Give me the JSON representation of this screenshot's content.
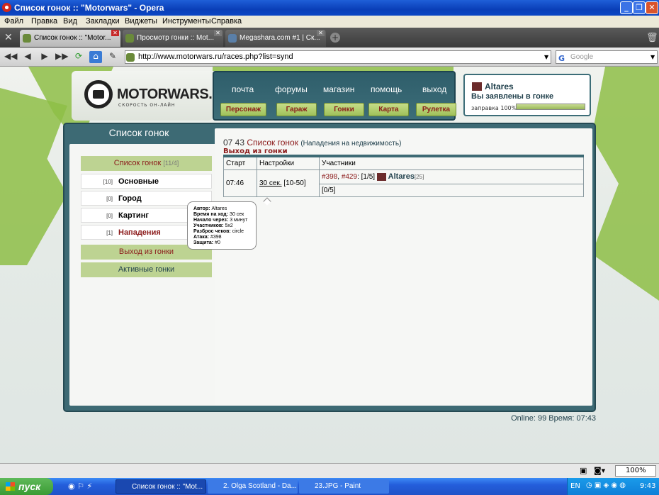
{
  "window": {
    "title": "Список гонок :: \"Motorwars\" - Opera"
  },
  "menu": [
    "Файл",
    "Правка",
    "Вид",
    "Закладки",
    "Виджеты",
    "Инструменты",
    "Справка"
  ],
  "tabs": [
    {
      "label": "Список гонок :: \"Motor...",
      "active": true
    },
    {
      "label": "Просмотр гонки :: Mot...",
      "active": false
    },
    {
      "label": "Megashara.com #1 | Ск...",
      "active": false
    }
  ],
  "address": {
    "url": "http://www.motorwars.ru/races.php?list=synd",
    "search_placeholder": "Google"
  },
  "site": {
    "logo": "MOTORWARS.RU",
    "slogan": "СКОРОСТЬ ОН-ЛАЙН",
    "top_nav": [
      "почта",
      "форумы",
      "магазин",
      "помощь",
      "выход"
    ],
    "sub_nav": [
      "Персонаж",
      "Гараж",
      "Гонки",
      "Карта",
      "Рулетка"
    ],
    "user": {
      "name": "Altares",
      "status": "Вы заявлены в гонке",
      "fuel_label": "заправка 100%",
      "fuel_fraction": 1.0
    }
  },
  "sidebar": {
    "title": "Список гонок",
    "header_item": {
      "label": "Список гонок",
      "count": "[11/4]"
    },
    "items": [
      {
        "count": "[10]",
        "label": "Основные"
      },
      {
        "count": "[0]",
        "label": "Город"
      },
      {
        "count": "[0]",
        "label": "Картинг"
      },
      {
        "count": "[1]",
        "label": "Нападения"
      }
    ],
    "exit": "Выход из гонки",
    "active": "Активные гонки"
  },
  "content": {
    "time": "07 43",
    "title": "Список гонок",
    "subtitle": "(Нападения на недвижимость)",
    "exit_link": "Выход из гонки",
    "table": {
      "headers": [
        "Старт",
        "Настройки",
        "Участники"
      ],
      "row": {
        "start": "07:46",
        "settings_link": "30 сек.",
        "settings_range": "[10-50]",
        "participants_a": "#398",
        "participants_b": "#429",
        "participants_count": "[1/5]",
        "participant_name": "Altares",
        "participant_level": "[25]",
        "defenders": "[0/5]"
      }
    },
    "tooltip": [
      {
        "k": "Автор:",
        "v": "Altares"
      },
      {
        "k": "Время на ход:",
        "v": "30 сек"
      },
      {
        "k": "Начало через:",
        "v": "3 минут"
      },
      {
        "k": "Участников:",
        "v": "5x2"
      },
      {
        "k": "Разброс чеков:",
        "v": "circle"
      },
      {
        "k": "Атака:",
        "v": "#398"
      },
      {
        "k": "Защита:",
        "v": "#0"
      }
    ]
  },
  "footer": {
    "online": "Online: 99  Время: 07:43"
  },
  "statusbar": {
    "zoom": "100%"
  },
  "taskbar": {
    "start": "пуск",
    "items": [
      "Список гонок :: \"Mot...",
      "2. Olga Scotland - Da...",
      "23.JPG - Paint"
    ],
    "lang": "EN",
    "clock": "9:43"
  }
}
